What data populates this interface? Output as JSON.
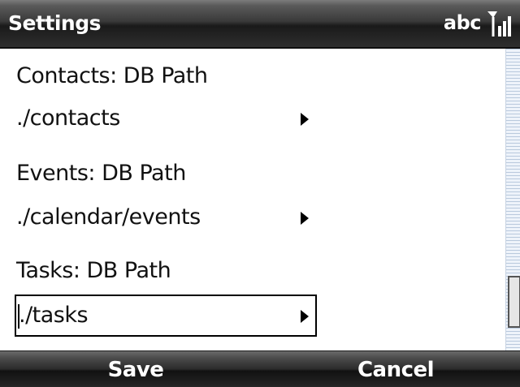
{
  "titlebar": {
    "title": "Settings",
    "input_mode": "abc",
    "signal_icon": "signal-strength-icon"
  },
  "settings": [
    {
      "label": "Contacts: DB Path",
      "value": "./contacts",
      "selected": false
    },
    {
      "label": "Events: DB Path",
      "value": "./calendar/events",
      "selected": false
    },
    {
      "label": "Tasks: DB Path",
      "value": "./tasks",
      "selected": true
    }
  ],
  "scrollbar": {
    "position": "bottom"
  },
  "softkeys": {
    "left": "Save",
    "right": "Cancel"
  },
  "colors": {
    "titlebar": "#2e2e2e",
    "softkeys": "#262626",
    "scrollbar_track": "#eef3fa",
    "text": "#111111"
  }
}
